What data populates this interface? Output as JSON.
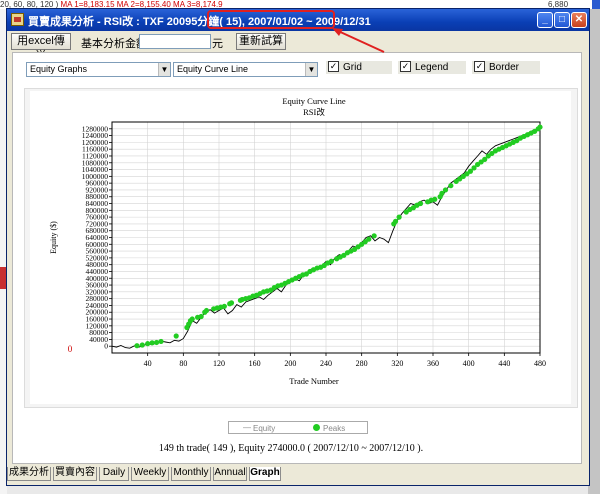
{
  "background": {
    "strip_text": "20, 60, 80, 120 )",
    "strip_red": "MA 1=8,183.15  MA 2=8,155.40  MA 3=8,174.9",
    "strip_right": "6,880"
  },
  "window": {
    "title_prefix": "買賣成果分析 - RSI改 : TXF 20095分鐘( 1",
    "title_range": "5), 2007/01/02 ~ 2009/12/31",
    "minimize_glyph": "_",
    "maximize_glyph": "□",
    "close_glyph": "✕"
  },
  "toolbar": {
    "excel_button": "用excel傳送",
    "capital_label": "基本分析金額",
    "capital_value": "",
    "unit_label": "元",
    "recalc_button": "重新試算"
  },
  "options": {
    "graph_type": "Equity Graphs",
    "graph_subtype": "Equity Curve Line",
    "grid_label": "Grid",
    "legend_label": "Legend",
    "border_label": "Border",
    "grid_checked": true,
    "legend_checked": true,
    "border_checked": true,
    "check_glyph": "✓"
  },
  "chart_data": {
    "type": "line",
    "title": "Equity Curve Line",
    "subtitle": "RSI改",
    "xlabel": "Trade Number",
    "ylabel": "Equity ($)",
    "xlim": [
      0,
      480
    ],
    "ylim": [
      -40000,
      1320000
    ],
    "xticks": [
      40,
      80,
      120,
      160,
      200,
      240,
      280,
      320,
      360,
      400,
      440,
      480
    ],
    "yticks": [
      0,
      40000,
      80000,
      120000,
      160000,
      200000,
      240000,
      280000,
      320000,
      360000,
      400000,
      440000,
      480000,
      520000,
      560000,
      600000,
      640000,
      680000,
      720000,
      760000,
      800000,
      840000,
      880000,
      920000,
      960000,
      1000000,
      1040000,
      1080000,
      1120000,
      1160000,
      1200000,
      1240000,
      1280000
    ],
    "zero_marker": "0",
    "grid": true,
    "legend_position": "bottom",
    "equity_color": "#000000",
    "peak_color": "#22cc22",
    "series": [
      {
        "name": "Equity",
        "x": [
          0,
          5,
          10,
          15,
          20,
          25,
          30,
          35,
          40,
          45,
          50,
          55,
          60,
          65,
          70,
          75,
          80,
          85,
          90,
          95,
          100,
          105,
          110,
          115,
          120,
          125,
          130,
          135,
          140,
          145,
          150,
          155,
          160,
          165,
          170,
          175,
          180,
          185,
          190,
          195,
          200,
          205,
          210,
          215,
          220,
          225,
          230,
          235,
          240,
          245,
          250,
          255,
          260,
          265,
          270,
          275,
          280,
          285,
          290,
          295,
          300,
          305,
          310,
          315,
          320,
          325,
          330,
          335,
          340,
          345,
          350,
          355,
          360,
          365,
          370,
          375,
          380,
          385,
          390,
          395,
          400,
          405,
          410,
          415,
          420,
          425,
          430,
          435,
          440,
          445,
          450,
          455,
          460,
          465,
          470,
          475,
          480
        ],
        "values": [
          0,
          -5000,
          4000,
          -8000,
          -12000,
          2000,
          -6000,
          3000,
          15000,
          8000,
          20000,
          30000,
          25000,
          20000,
          35000,
          30000,
          45000,
          90000,
          150000,
          135000,
          170000,
          200000,
          215000,
          195000,
          210000,
          225000,
          190000,
          210000,
          245000,
          230000,
          260000,
          270000,
          280000,
          290000,
          275000,
          300000,
          320000,
          340000,
          320000,
          360000,
          380000,
          400000,
          385000,
          420000,
          440000,
          460000,
          450000,
          470000,
          500000,
          480000,
          520000,
          540000,
          530000,
          560000,
          590000,
          580000,
          610000,
          640000,
          650000,
          620000,
          640000,
          630000,
          610000,
          680000,
          740000,
          780000,
          810000,
          840000,
          830000,
          850000,
          860000,
          840000,
          850000,
          830000,
          880000,
          920000,
          960000,
          980000,
          1000000,
          1020000,
          1060000,
          1090000,
          1120000,
          1150000,
          1130000,
          1160000,
          1180000,
          1190000,
          1200000,
          1210000,
          1220000,
          1230000,
          1240000,
          1250000,
          1265000,
          1275000,
          1290000
        ]
      },
      {
        "name": "Peaks",
        "x": [
          28,
          34,
          40,
          45,
          50,
          55,
          72,
          84,
          86,
          88,
          90,
          96,
          100,
          104,
          106,
          114,
          118,
          122,
          126,
          132,
          134,
          144,
          146,
          150,
          154,
          158,
          162,
          166,
          170,
          174,
          178,
          182,
          186,
          190,
          194,
          198,
          202,
          206,
          210,
          214,
          218,
          222,
          226,
          230,
          234,
          238,
          242,
          246,
          252,
          256,
          260,
          264,
          268,
          272,
          276,
          280,
          284,
          288,
          294,
          316,
          318,
          322,
          330,
          334,
          338,
          342,
          346,
          354,
          358,
          362,
          368,
          370,
          374,
          380,
          386,
          390,
          394,
          398,
          402,
          406,
          410,
          414,
          418,
          422,
          426,
          430,
          434,
          438,
          442,
          446,
          450,
          454,
          458,
          462,
          466,
          470,
          474,
          478,
          480
        ],
        "values": [
          3000,
          7000,
          15000,
          20000,
          22000,
          28000,
          60000,
          110000,
          130000,
          150000,
          160000,
          170000,
          175000,
          200000,
          210000,
          220000,
          225000,
          230000,
          235000,
          250000,
          255000,
          270000,
          275000,
          280000,
          285000,
          295000,
          300000,
          310000,
          320000,
          325000,
          330000,
          345000,
          355000,
          360000,
          370000,
          380000,
          390000,
          400000,
          410000,
          420000,
          425000,
          440000,
          450000,
          460000,
          465000,
          475000,
          490000,
          500000,
          515000,
          525000,
          535000,
          550000,
          560000,
          570000,
          585000,
          600000,
          615000,
          630000,
          650000,
          720000,
          735000,
          760000,
          790000,
          805000,
          815000,
          830000,
          840000,
          850000,
          860000,
          865000,
          880000,
          900000,
          920000,
          945000,
          970000,
          985000,
          1000000,
          1015000,
          1030000,
          1050000,
          1070000,
          1085000,
          1100000,
          1120000,
          1135000,
          1150000,
          1160000,
          1170000,
          1180000,
          1190000,
          1200000,
          1210000,
          1225000,
          1235000,
          1245000,
          1255000,
          1265000,
          1280000,
          1290000
        ]
      }
    ]
  },
  "legend": {
    "equity_label": "Equity",
    "peaks_label": "Peaks"
  },
  "status": {
    "text": "149 th trade( 149 ), Equity  274000.0 ( 2007/12/10 ~ 2007/12/10 )."
  },
  "tabs": [
    {
      "label": "成果分析"
    },
    {
      "label": "買賣內容"
    },
    {
      "label": "Daily"
    },
    {
      "label": "Weekly"
    },
    {
      "label": "Monthly"
    },
    {
      "label": "Annual"
    },
    {
      "label": "Graph"
    }
  ]
}
